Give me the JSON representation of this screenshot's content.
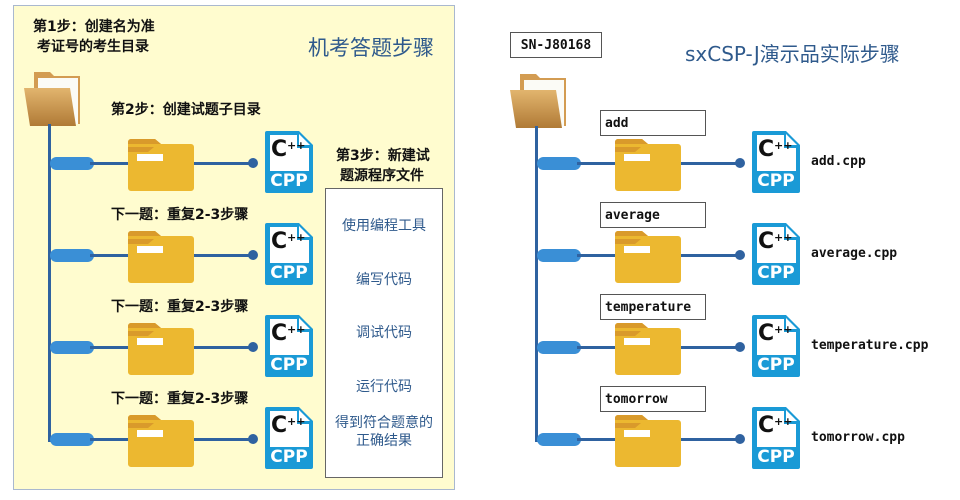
{
  "left": {
    "title": "机考答题步骤",
    "step1_line1": "第1步：创建名为准",
    "step1_line2": "考证号的考生目录",
    "step2": "第2步：创建试题子目录",
    "step3_line1": "第3步：新建试",
    "step3_line2": "题源程序文件",
    "repeat_labels": [
      "下一题：重复2-3步骤",
      "下一题：重复2-3步骤",
      "下一题：重复2-3步骤"
    ],
    "process": [
      "使用编程工具",
      "编写代码",
      "调试代码",
      "运行代码",
      "得到符合题意的",
      "正确结果"
    ],
    "cpp_label": "CPP",
    "cpp_symbol": "C",
    "cpp_plus": "++"
  },
  "right": {
    "title": "sxCSP-J演示品实际步骤",
    "root_folder": "SN-J80168",
    "folders": [
      "add",
      "average",
      "temperature",
      "tomorrow"
    ],
    "files": [
      "add.cpp",
      "average.cpp",
      "temperature.cpp",
      "tomorrow.cpp"
    ]
  },
  "colors": {
    "panel_bg": "#fffccf",
    "title_blue": "#2f5a8c",
    "trunk_blue": "#2f62a0",
    "pill_blue": "#3a8fd6",
    "folder_yellow": "#ecb830",
    "cpp_blue": "#1a9ad6"
  }
}
